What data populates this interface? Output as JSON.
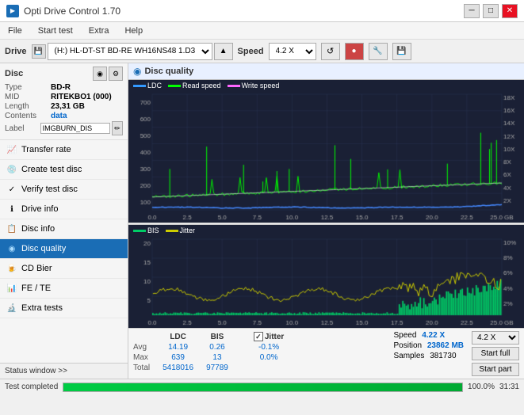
{
  "app": {
    "title": "Opti Drive Control 1.70",
    "icon": "▶"
  },
  "titlebar": {
    "minimize_label": "─",
    "maximize_label": "□",
    "close_label": "✕"
  },
  "menu": {
    "items": [
      "File",
      "Start test",
      "Extra",
      "Help"
    ]
  },
  "drivebar": {
    "drive_label": "Drive",
    "drive_value": "(H:)  HL-DT-ST BD-RE  WH16NS48 1.D3",
    "speed_label": "Speed",
    "speed_value": "4.2 X"
  },
  "disc": {
    "title": "Disc",
    "type_label": "Type",
    "type_value": "BD-R",
    "mid_label": "MID",
    "mid_value": "RITEKBO1 (000)",
    "length_label": "Length",
    "length_value": "23,31 GB",
    "contents_label": "Contents",
    "contents_value": "data",
    "label_label": "Label",
    "label_value": "IMGBURN_DIS"
  },
  "nav": {
    "items": [
      {
        "id": "transfer-rate",
        "label": "Transfer rate",
        "icon": "📈"
      },
      {
        "id": "create-test-disc",
        "label": "Create test disc",
        "icon": "💿"
      },
      {
        "id": "verify-test-disc",
        "label": "Verify test disc",
        "icon": "✓"
      },
      {
        "id": "drive-info",
        "label": "Drive info",
        "icon": "ℹ"
      },
      {
        "id": "disc-info",
        "label": "Disc info",
        "icon": "📋"
      },
      {
        "id": "disc-quality",
        "label": "Disc quality",
        "icon": "★",
        "active": true
      },
      {
        "id": "cd-bier",
        "label": "CD Bier",
        "icon": "🍺"
      },
      {
        "id": "fe-te",
        "label": "FE / TE",
        "icon": "📊"
      },
      {
        "id": "extra-tests",
        "label": "Extra tests",
        "icon": "🔬"
      }
    ],
    "status_window": "Status window >>"
  },
  "chart": {
    "title": "Disc quality",
    "icon": "◉",
    "legend_top": [
      "LDC",
      "Read speed",
      "Write speed"
    ],
    "legend_bottom": [
      "BIS",
      "Jitter"
    ],
    "y_left_top": [
      "700",
      "600",
      "500",
      "400",
      "300",
      "200",
      "100"
    ],
    "y_right_top": [
      "18X",
      "16X",
      "14X",
      "12X",
      "10X",
      "8X",
      "6X",
      "4X",
      "2X"
    ],
    "y_left_bottom": [
      "20",
      "15",
      "10",
      "5"
    ],
    "y_right_bottom": [
      "10%",
      "8%",
      "6%",
      "4%",
      "2%"
    ],
    "x_labels": [
      "0.0",
      "2.5",
      "5.0",
      "7.5",
      "10.0",
      "12.5",
      "15.0",
      "17.5",
      "20.0",
      "22.5",
      "25.0 GB"
    ]
  },
  "stats": {
    "headers": [
      "",
      "LDC",
      "BIS",
      "",
      "Jitter",
      "Speed",
      ""
    ],
    "avg_label": "Avg",
    "avg_ldc": "14.19",
    "avg_bis": "0.26",
    "avg_jitter": "-0.1%",
    "max_label": "Max",
    "max_ldc": "639",
    "max_bis": "13",
    "max_jitter": "0.0%",
    "total_label": "Total",
    "total_ldc": "5418016",
    "total_bis": "97789",
    "speed_label": "Speed",
    "speed_value": "4.22 X",
    "position_label": "Position",
    "position_value": "23862 MB",
    "samples_label": "Samples",
    "samples_value": "381730",
    "jitter_checked": true,
    "speed_dropdown": "4.2 X",
    "btn_start_full": "Start full",
    "btn_start_part": "Start part"
  },
  "progress": {
    "status_label": "Test completed",
    "percent": 100,
    "percent_text": "100.0%",
    "time": "31:31"
  }
}
